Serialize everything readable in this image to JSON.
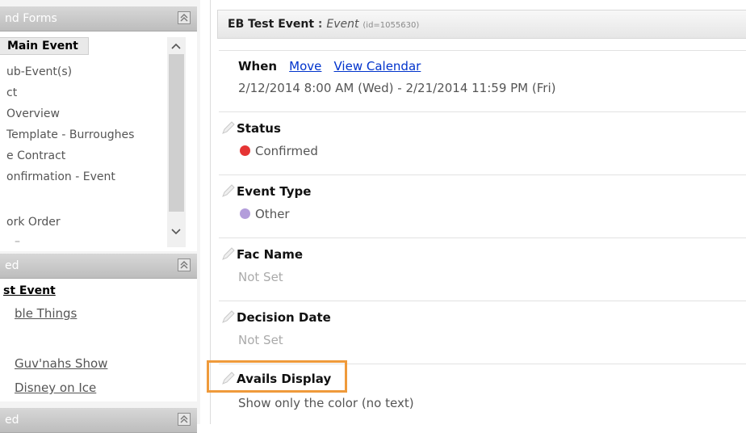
{
  "sidebar": {
    "panels": [
      {
        "title": "nd Forms",
        "items": [
          {
            "label": "Main Event",
            "state": "selected"
          },
          {
            "label": "ub-Event(s)"
          },
          {
            "label": "ct"
          },
          {
            "label": "Overview"
          },
          {
            "label": "Template - Burroughes"
          },
          {
            "label": "e Contract"
          },
          {
            "label": "onfirmation - Event"
          },
          {
            "label": "ork Order"
          }
        ]
      },
      {
        "title": "ed",
        "items": [
          {
            "label": "st Event",
            "style": "bold"
          },
          {
            "label": "ble Things",
            "style": "link"
          },
          {
            "label": "Guv'nahs Show",
            "style": "link"
          },
          {
            "label": "Disney on Ice",
            "style": "link"
          }
        ]
      },
      {
        "title": "ed"
      }
    ]
  },
  "main": {
    "header": {
      "title": "EB Test Event",
      "separator": " : ",
      "type": "Event",
      "id": "(id=1055630)"
    },
    "when": {
      "label": "When",
      "move_link": "Move",
      "calendar_link": "View Calendar",
      "range": "2/12/2014 8:00 AM (Wed) - 2/21/2014 11:59 PM (Fri)"
    },
    "fields": [
      {
        "label": "Status",
        "value": "Confirmed",
        "dot_color": "#e53434"
      },
      {
        "label": "Event Type",
        "value": "Other",
        "dot_color": "#b39ddb"
      },
      {
        "label": "Fac Name",
        "value": "Not Set"
      },
      {
        "label": "Decision Date",
        "value": "Not Set"
      },
      {
        "label": "Avails Display",
        "value": "Show only the color (no text)"
      }
    ],
    "highlight_color": "#ef9a3b"
  }
}
